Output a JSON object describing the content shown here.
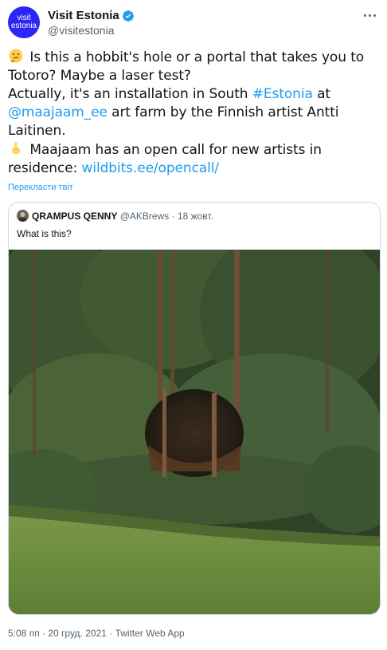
{
  "author": {
    "avatar_line1": "visit",
    "avatar_line2": "estonia",
    "display_name": "Visit Estonia",
    "handle": "@visitestonia",
    "verified": true
  },
  "tweet": {
    "line1_a": "Is this a hobbit's hole or a portal that takes you to",
    "line1_b": "Totoro? Maybe a laser test?",
    "line2_a": "Actually, it's an installation in South ",
    "hashtag": "#Estonia",
    "line2_b": " at",
    "mention": "@maajaam_ee",
    "line3_a": " art farm by the Finnish artist Antti",
    "line3_b": "Laitinen.",
    "line4_a": "Maajaam has an open call for new artists in",
    "line4_b": "residence: ",
    "url": "wildbits.ee/opencall/",
    "emoji1": "thinking-face",
    "emoji2": "pointing-up-hand"
  },
  "translate_label": "Перекласти твіт",
  "quoted": {
    "display_name": "QRAMPUS QENNY",
    "handle": "@AKBrews",
    "separator": " · ",
    "date": "18 жовт.",
    "text": "What is this?",
    "image": "forest-hole-photo"
  },
  "footer": "5:08 пп · 20 груд. 2021 · Twitter Web App",
  "colors": {
    "link": "#1d9bf0",
    "avatar_bg": "#2b26f5",
    "muted": "#536471",
    "border": "#cfd9de"
  }
}
